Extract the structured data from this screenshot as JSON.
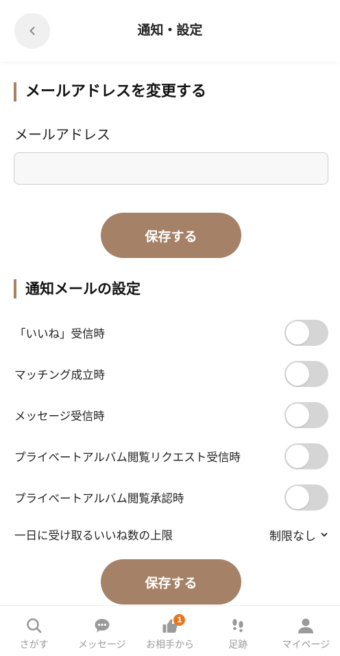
{
  "header": {
    "title": "通知・設定"
  },
  "email_section": {
    "heading": "メールアドレスを変更する",
    "field_label": "メールアドレス",
    "input_value": "",
    "save_label": "保存する"
  },
  "notification_section": {
    "heading": "通知メールの設定",
    "items": [
      {
        "label": "「いいね」受信時",
        "enabled": false
      },
      {
        "label": "マッチング成立時",
        "enabled": false
      },
      {
        "label": "メッセージ受信時",
        "enabled": false
      },
      {
        "label": "プライベートアルバム閲覧リクエスト受信時",
        "enabled": false
      },
      {
        "label": "プライベートアルバム閲覧承認時",
        "enabled": false
      }
    ],
    "limit_label": "一日に受け取るいいね数の上限",
    "limit_value": "制限なし",
    "save_label": "保存する"
  },
  "bottom_nav": {
    "items": [
      {
        "label": "さがす",
        "icon": "search-icon"
      },
      {
        "label": "メッセージ",
        "icon": "chat-icon"
      },
      {
        "label": "お相手から",
        "icon": "thumbs-up-icon",
        "badge": "1"
      },
      {
        "label": "足跡",
        "icon": "footprints-icon"
      },
      {
        "label": "マイページ",
        "icon": "person-icon"
      }
    ]
  },
  "colors": {
    "accent": "#a58167",
    "badge": "#e8761f",
    "toggle_off": "#d5d5d5",
    "nav_icon": "#9a9a9a"
  }
}
